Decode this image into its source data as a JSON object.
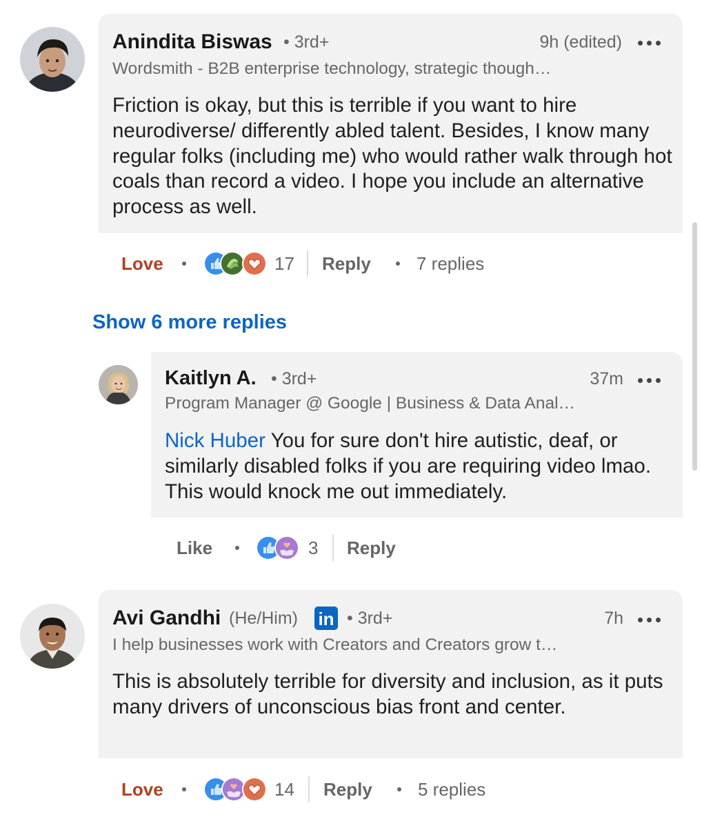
{
  "comments": [
    {
      "name": "Anindita Biswas",
      "degree": "• 3rd+",
      "time": "9h (edited)",
      "headline": "Wordsmith - B2B enterprise technology, strategic though…",
      "body": "Friction is okay, but this is terrible if you want to hire neurodiverse/ differently abled talent. Besides, I know many regular folks (including me) who would rather walk through hot coals than record a video. I hope you include an alternative process as well.",
      "reaction_label": "Love",
      "reaction_icons": [
        "like-icon",
        "support-icon",
        "love-icon"
      ],
      "reaction_count": "17",
      "reply_label": "Reply",
      "replies_count": "7 replies"
    },
    {
      "name": "Avi Gandhi",
      "pronouns": "(He/Him)",
      "badge": "in",
      "degree": "• 3rd+",
      "time": "7h",
      "headline": "I help businesses work with Creators and Creators grow t…",
      "body": "This is absolutely terrible for diversity and inclusion, as it puts many drivers of unconscious bias front and center.",
      "reaction_label": "Love",
      "reaction_icons": [
        "like-icon",
        "care-icon",
        "love-icon"
      ],
      "reaction_count": "14",
      "reply_label": "Reply",
      "replies_count": "5 replies"
    }
  ],
  "show_more": "Show 6 more replies",
  "reply": {
    "name": "Kaitlyn A.",
    "degree": "• 3rd+",
    "time": "37m",
    "headline": "Program Manager @ Google | Business & Data Anal…",
    "mention": "Nick Huber",
    "body": " You for sure don't hire autistic, deaf, or similarly disabled folks if you are requiring video lmao. This would knock me out immediately.",
    "reaction_label": "Like",
    "reaction_icons": [
      "like-icon",
      "care-icon"
    ],
    "reaction_count": "3",
    "reply_label": "Reply"
  },
  "colors": {
    "accent": "#0a66c2",
    "love": "#b24020",
    "bubble": "#f2f2f2",
    "muted": "#666666"
  }
}
